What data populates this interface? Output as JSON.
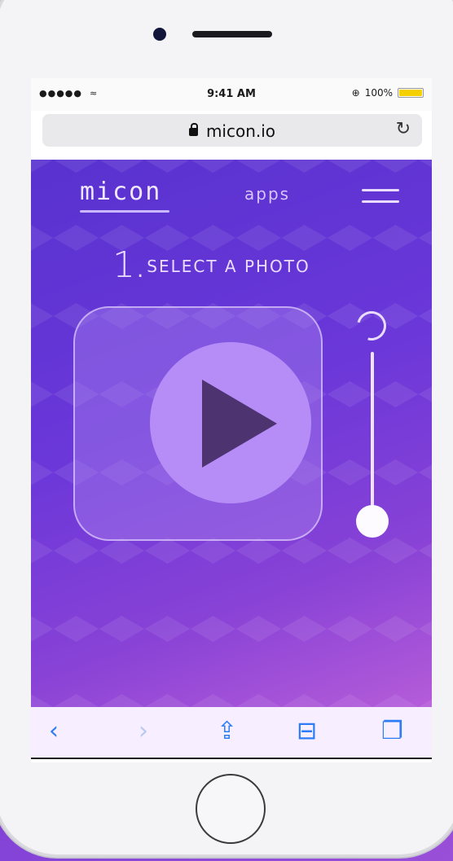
{
  "status": {
    "signal": "●●●●●",
    "wifi": "≈",
    "time": "9:41 AM",
    "battery_pct": "100%",
    "alarm": "⊕"
  },
  "browser": {
    "url": "micon.io",
    "reload": "↻"
  },
  "site": {
    "logo": "micon",
    "nav_apps": "apps",
    "step_number": "1",
    "step_dot": ".",
    "step_title": "SELECT A PHOTO",
    "slider_level": 0.0
  },
  "toolbar": {
    "back": "‹",
    "forward": "›",
    "share": "⇪",
    "bookmarks": "⊟",
    "tabs": "❐"
  },
  "colors": {
    "accent": "#2b7cf5",
    "brand_gradient_start": "#5832cf",
    "brand_gradient_end": "#b55cd9"
  }
}
